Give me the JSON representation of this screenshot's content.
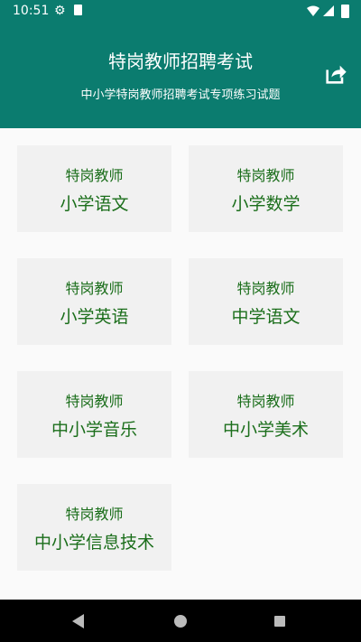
{
  "status_bar": {
    "time": "10:51",
    "icons": [
      "gear-icon",
      "sd-card-icon",
      "wifi-icon",
      "signal-icon",
      "battery-icon"
    ]
  },
  "header": {
    "title": "特岗教师招聘考试",
    "subtitle": "中小学特岗教师招聘考试专项练习试题",
    "share_icon": "share-icon"
  },
  "cards": [
    {
      "top": "特岗教师",
      "bottom": "小学语文"
    },
    {
      "top": "特岗教师",
      "bottom": "小学数学"
    },
    {
      "top": "特岗教师",
      "bottom": "小学英语"
    },
    {
      "top": "特岗教师",
      "bottom": "中学语文"
    },
    {
      "top": "特岗教师",
      "bottom": "中小学音乐"
    },
    {
      "top": "特岗教师",
      "bottom": "中小学美术"
    },
    {
      "top": "特岗教师",
      "bottom": "中小学信息技术"
    }
  ],
  "colors": {
    "primary": "#0b7c6f",
    "card_bg": "#f1f1f1",
    "card_text": "#1b6e1b"
  }
}
